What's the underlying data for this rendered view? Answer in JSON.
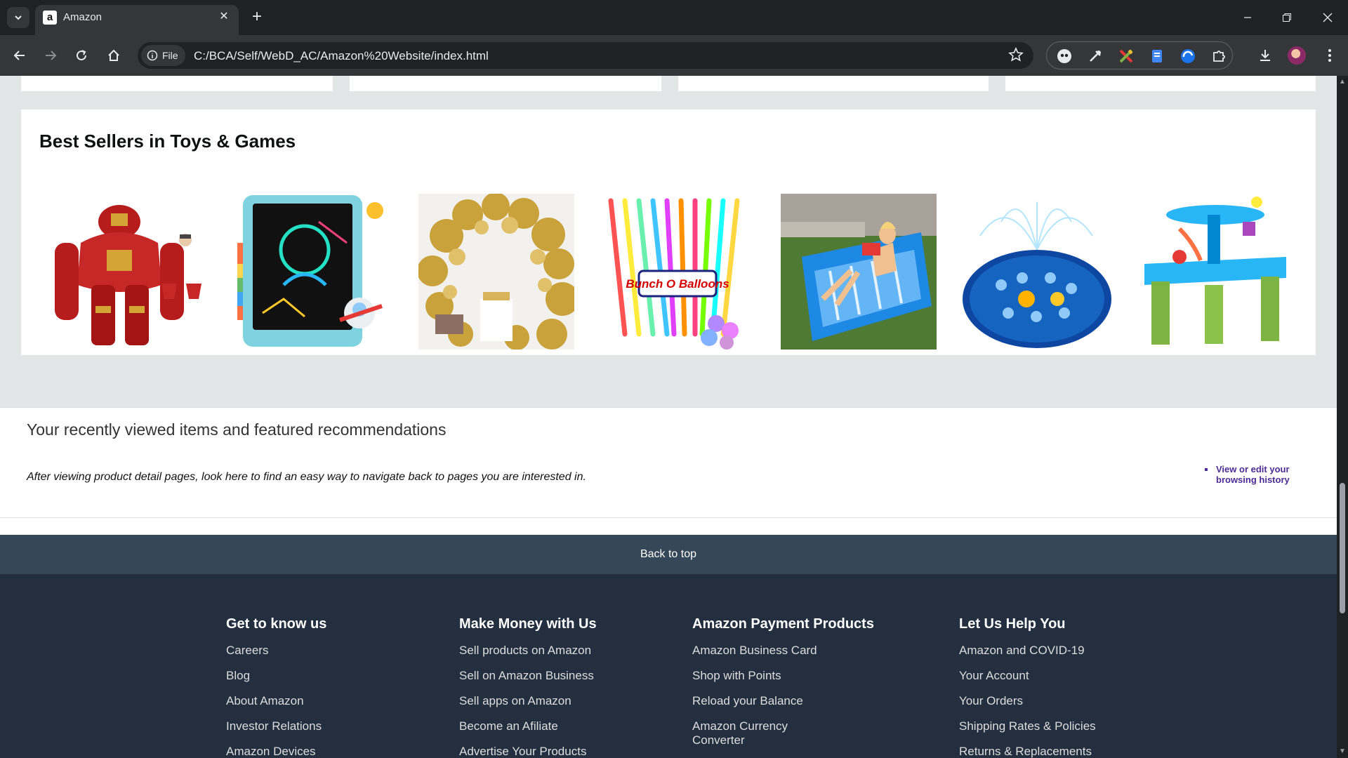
{
  "browser": {
    "tab_title": "Amazon",
    "favicon": "a",
    "site_chip": "File",
    "url": "C:/BCA/Self/WebD_AC/Amazon%20Website/index.html"
  },
  "bestsellers": {
    "title": "Best Sellers in Toys & Games",
    "items": [
      {
        "name": "red-armored-action-figure"
      },
      {
        "name": "kids-drawing-tablet"
      },
      {
        "name": "gold-balloon-arch"
      },
      {
        "name": "bunch-o-balloons-water-balloons",
        "label": "Bunch O Balloons"
      },
      {
        "name": "inflatable-pool-lounger"
      },
      {
        "name": "splash-pad-sprinkler-mat"
      },
      {
        "name": "water-table-toy"
      }
    ]
  },
  "recent": {
    "title": "Your recently viewed items and featured recommendations",
    "description": "After viewing product detail pages, look here to find an easy way to navigate back to pages you are interested in.",
    "link": "View or edit your browsing history"
  },
  "back_to_top": "Back to top",
  "footer": {
    "columns": [
      {
        "heading": "Get to know us",
        "links": [
          "Careers",
          "Blog",
          "About Amazon",
          "Investor Relations",
          "Amazon Devices"
        ]
      },
      {
        "heading": "Make Money with Us",
        "links": [
          "Sell products on Amazon",
          "Sell on Amazon Business",
          "Sell apps on Amazon",
          "Become an Afiliate",
          "Advertise Your Products"
        ]
      },
      {
        "heading": "Amazon Payment Products",
        "links": [
          "Amazon Business Card",
          "Shop with Points",
          "Reload your Balance",
          "Amazon Currency Converter"
        ]
      },
      {
        "heading": "Let Us Help You",
        "links": [
          "Amazon and COVID-19",
          "Your Account",
          "Your Orders",
          "Shipping Rates & Policies",
          "Returns & Replacements"
        ]
      }
    ]
  },
  "colors": {
    "page_bg": "#e3e6e6",
    "back_to_top_bg": "#37475a",
    "footer_bg": "#232f3e",
    "history_link": "#4d2a95"
  }
}
